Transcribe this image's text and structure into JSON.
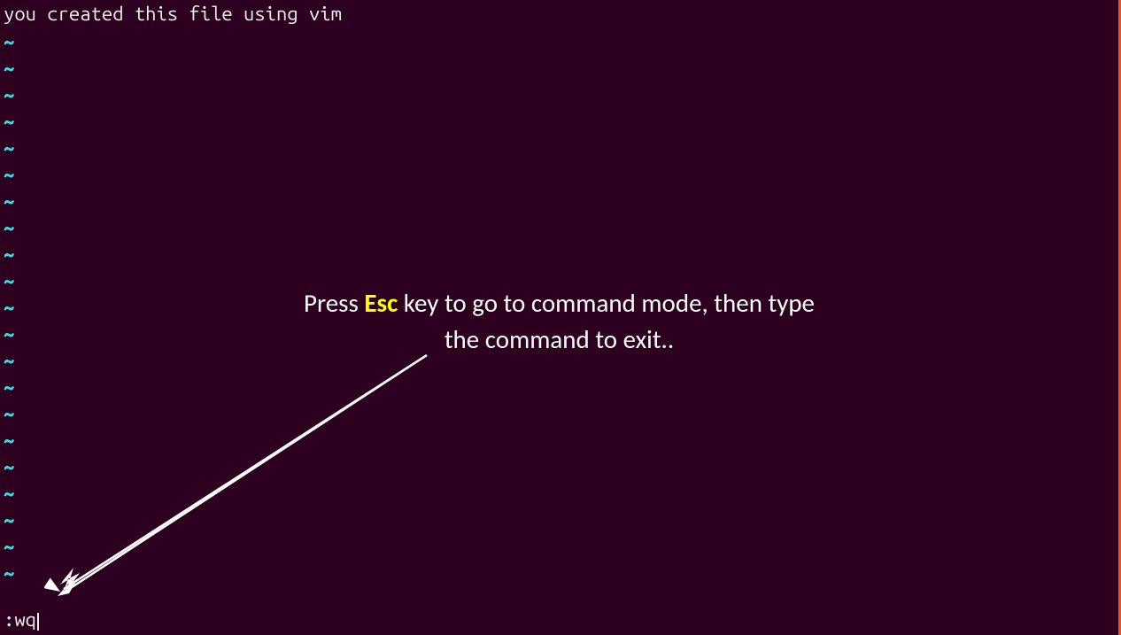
{
  "editor": {
    "file_content_line": "you created this file using vim",
    "tilde_char": "~",
    "tilde_count": 21,
    "command_text": ":wq"
  },
  "annotation": {
    "prefix": "Press ",
    "highlight": "Esc",
    "suffix1": " key to go to command mode, then type",
    "line2": "the command to exit.."
  }
}
